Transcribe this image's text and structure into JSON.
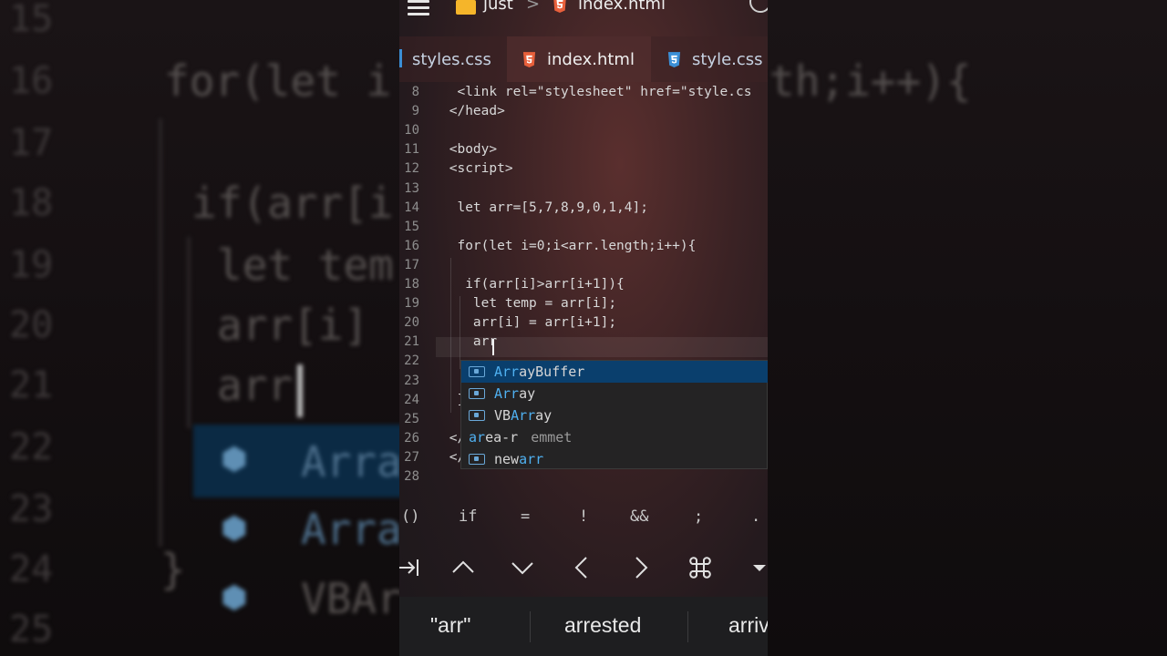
{
  "header": {
    "folder": "just",
    "separator": ">",
    "file": "index.html"
  },
  "tabs": [
    {
      "label": "styles.css",
      "icon": "css-file-icon",
      "active": false
    },
    {
      "label": "index.html",
      "icon": "html-file-icon",
      "active": true
    },
    {
      "label": "style.css",
      "icon": "css-file-icon",
      "active": false
    }
  ],
  "code_lines": [
    {
      "n": "8",
      "text": "  <link rel=\"stylesheet\" href=\"style.cs"
    },
    {
      "n": "9",
      "text": " </head>"
    },
    {
      "n": "10",
      "text": ""
    },
    {
      "n": "11",
      "text": " <body>"
    },
    {
      "n": "12",
      "text": " <script>"
    },
    {
      "n": "13",
      "text": ""
    },
    {
      "n": "14",
      "text": "  let arr=[5,7,8,9,0,1,4];"
    },
    {
      "n": "15",
      "text": ""
    },
    {
      "n": "16",
      "text": "  for(let i=0;i<arr.length;i++){"
    },
    {
      "n": "17",
      "text": ""
    },
    {
      "n": "18",
      "text": "   if(arr[i]>arr[i+1]){"
    },
    {
      "n": "19",
      "text": "    let temp = arr[i];"
    },
    {
      "n": "20",
      "text": "    arr[i] = arr[i+1];"
    },
    {
      "n": "21",
      "text": "    arr"
    },
    {
      "n": "22",
      "text": ""
    },
    {
      "n": "23",
      "text": ""
    },
    {
      "n": "24",
      "text": "  }"
    },
    {
      "n": "25",
      "text": ""
    },
    {
      "n": "26",
      "text": " </"
    },
    {
      "n": "27",
      "text": " </"
    },
    {
      "n": "28",
      "text": ""
    }
  ],
  "suggestions": [
    {
      "match": "Arr",
      "rest": "ayBuffer",
      "prefix": "",
      "hint": "",
      "icon": true,
      "selected": true
    },
    {
      "match": "Arr",
      "rest": "ay",
      "prefix": "",
      "hint": "",
      "icon": true,
      "selected": false
    },
    {
      "match": "Arr",
      "rest": "ay",
      "prefix": "VB",
      "hint": "",
      "icon": true,
      "selected": false
    },
    {
      "match": "ar",
      "rest": "ea-r",
      "prefix": "",
      "hint": "emmet",
      "icon": false,
      "selected": false
    },
    {
      "match": "arr",
      "rest": "",
      "prefix": "new",
      "hint": "",
      "icon": true,
      "selected": false
    }
  ],
  "symbols": [
    "()",
    "if",
    "=",
    "!",
    "&&",
    ";",
    "."
  ],
  "nav_icons": [
    "tab-icon",
    "arrow-up-icon",
    "arrow-down-icon",
    "arrow-left-icon",
    "arrow-right-icon",
    "command-icon",
    "dropdown-icon"
  ],
  "keyboard_suggestions": [
    "\"arr\"",
    "arrested",
    "arriv"
  ],
  "background": {
    "line_numbers": [
      "15",
      "16",
      "17",
      "18",
      "19",
      "20",
      "21",
      "22",
      "23",
      "24",
      "25"
    ],
    "code": [
      "for(let i",
      "th;i++){",
      "if(arr[i",
      "let tem",
      "arr[i]",
      "arr",
      "Arra",
      "Arra",
      "}",
      "VBAr"
    ]
  },
  "colors": {
    "accent": "#0a3f6d",
    "match": "#4fb0f0",
    "folder": "#f5b52a",
    "html_icon": "#e8603c",
    "css_icon": "#3b8fd6"
  }
}
